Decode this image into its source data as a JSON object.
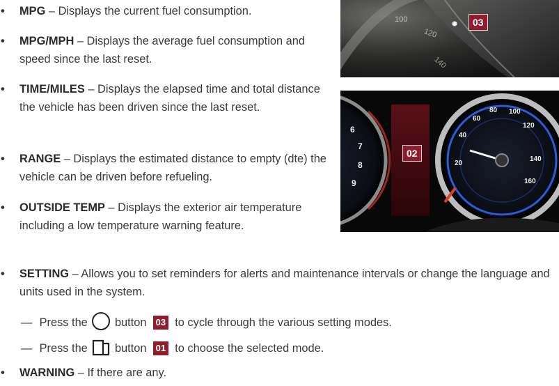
{
  "items": [
    {
      "term": "MPG",
      "text": " – Displays the current fuel consumption."
    },
    {
      "term": "MPG/MPH",
      "text": " – Displays the average fuel consumption and speed since the last reset."
    },
    {
      "term": "TIME/MILES",
      "text": " – Displays the elapsed time and total distance the vehicle has been driven since the last reset."
    },
    {
      "term": "RANGE",
      "text": " – Displays the estimated distance to empty (dte) the vehicle can be driven before refueling."
    },
    {
      "term": "OUTSIDE TEMP",
      "text": " – Displays the exterior air temperature including a low temperature warning feature."
    },
    {
      "term": "SETTING",
      "text": " – Allows you to set reminders for alerts and maintenance intervals or change the language and units used in the system."
    },
    {
      "term": "WARNING",
      "text": " – If there are any."
    }
  ],
  "sub_steps": [
    {
      "dash": "—",
      "pre": "Press the",
      "icon": "circle-button-icon",
      "post": "button",
      "badge": "03",
      "rest": "to cycle through the various setting modes."
    },
    {
      "dash": "—",
      "pre": "Press the",
      "icon": "square-button-icon",
      "post": "button",
      "badge": "01",
      "rest": "to choose the selected mode."
    }
  ],
  "photos": {
    "top": {
      "label": "03",
      "gauge_nums": [
        "100",
        "120",
        "140"
      ]
    },
    "bottom": {
      "label": "02",
      "left_nums": [
        "6",
        "7",
        "8",
        "9"
      ],
      "right_nums": [
        "60",
        "80",
        "100",
        "120",
        "140",
        "160",
        "40",
        "20"
      ]
    }
  },
  "colors": {
    "badge": "#8f1d2c",
    "gauge_blue": "#2a5bd8"
  }
}
